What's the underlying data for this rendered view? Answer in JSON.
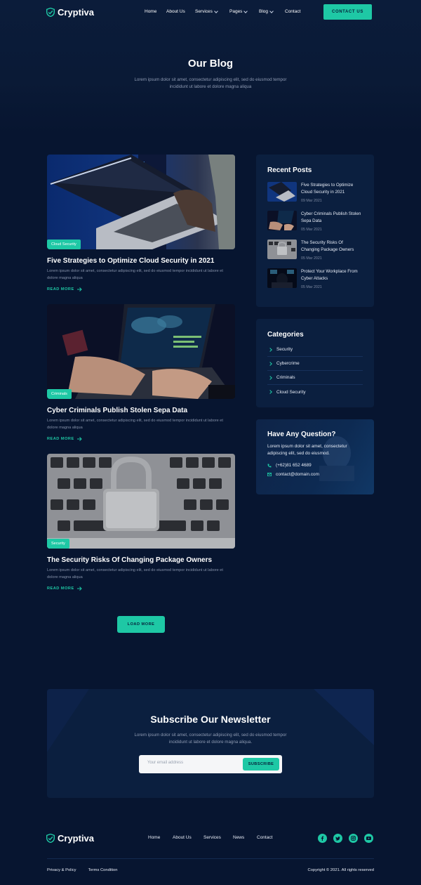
{
  "brand": {
    "name": "Cryptiva"
  },
  "nav": {
    "items": [
      {
        "label": "Home"
      },
      {
        "label": "About Us"
      },
      {
        "label": "Services"
      },
      {
        "label": "Pages"
      },
      {
        "label": "Blog"
      },
      {
        "label": "Contact"
      }
    ],
    "cta_label": "CONTACT US"
  },
  "hero": {
    "title": "Our Blog",
    "subtitle": "Lorem ipsum dolor sit amet, consectetur adipiscing elit, sed do eiusmod tempor incididunt ut labore et dolore magna aliqua"
  },
  "posts": [
    {
      "category": "Cloud Security",
      "title": "Five Strategies to Optimize Cloud Security in 2021",
      "excerpt": "Lorem ipsum dolor sit amet, consectetur adipiscing elit, sed do eiusmod tempor incididunt ut labore et dolore magna aliqua",
      "read_more": "READ MORE"
    },
    {
      "category": "Criminals",
      "title": "Cyber Criminals Publish Stolen Sepa Data",
      "excerpt": "Lorem ipsum dolor sit amet, consectetur adipiscing elit, sed do eiusmod tempor incididunt ut labore et dolore magna aliqua",
      "read_more": "READ MORE"
    },
    {
      "category": "Security",
      "title": "The Security Risks Of Changing Package Owners",
      "excerpt": "Lorem ipsum dolor sit amet, consectetur adipiscing elit, sed do eiusmod tempor incididunt ut labore et dolore magna aliqua",
      "read_more": "READ MORE"
    }
  ],
  "load_more_label": "LOAD MORE",
  "recent_posts": {
    "title": "Recent Posts",
    "items": [
      {
        "title": "Five Strategies to Optimize Cloud Security in 2021",
        "date": "09 Mar 2021"
      },
      {
        "title": "Cyber Criminals Publish Stolen Sepa Data",
        "date": "05 Mar 2021"
      },
      {
        "title": "The Security Risks Of Changing Package Owners",
        "date": "05 Mar 2021"
      },
      {
        "title": "Protect Your Workplace From Cyber Attacks",
        "date": "05 Mar 2021"
      }
    ]
  },
  "categories": {
    "title": "Categories",
    "items": [
      "Security",
      "Cybercrime",
      "Criminals",
      "Cloud Security"
    ]
  },
  "question": {
    "title": "Have Any Question?",
    "text": "Lorem ipsum dolor sit amet, consectetur adipiscing elit, sed do eiusmod.",
    "phone": "(+62)81 652 4689",
    "email": "contact@domain.com"
  },
  "newsletter": {
    "title": "Subscribe Our Newsletter",
    "subtitle": "Lorem ipsum dolor sit amet, consectetur adipiscing elit, sed do eiusmod tempor incididunt ut labore et dolore magna aliqua.",
    "placeholder": "Your email address",
    "button": "SUBSCRIBE"
  },
  "footer": {
    "nav": [
      "Home",
      "About Us",
      "Services",
      "News",
      "Contact"
    ],
    "links": [
      "Privacy & Policy",
      "Terms Condition"
    ],
    "copyright": "Copyright © 2021. All rights reserved",
    "social": [
      "facebook-icon",
      "twitter-icon",
      "instagram-icon",
      "youtube-icon"
    ]
  },
  "colors": {
    "accent": "#1ec8a5",
    "background": "#071530",
    "card": "#0b1f3f"
  }
}
